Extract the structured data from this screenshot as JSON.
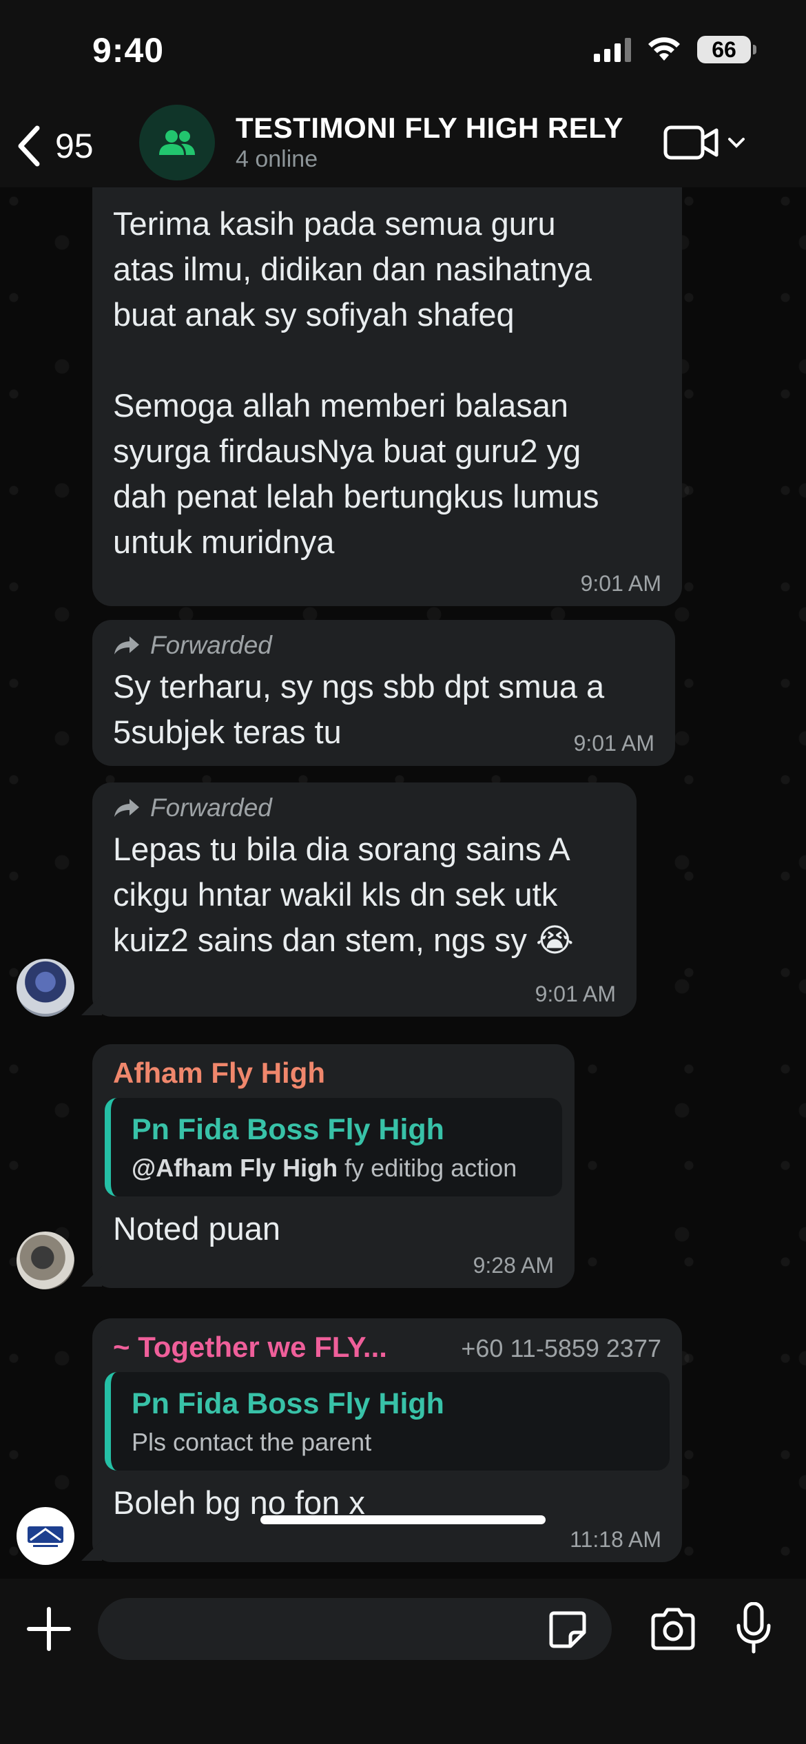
{
  "status_bar": {
    "time": "9:40",
    "battery": "66"
  },
  "header": {
    "back_count": "95",
    "title": "TESTIMONI FLY HIGH RELY",
    "subtitle": "4 online"
  },
  "messages": [
    {
      "text": "Terima kasih pada semua guru\natas ilmu, didikan dan nasihatnya\nbuat anak sy sofiyah shafeq\n\nSemoga allah memberi balasan\nsyurga firdausNya buat guru2 yg\ndah penat lelah bertungkus lumus\nuntuk muridnya",
      "time": "9:01 AM"
    },
    {
      "forwarded": "Forwarded",
      "text": "Sy terharu, sy ngs sbb dpt smua a\n5subjek teras tu",
      "time": "9:01 AM"
    },
    {
      "forwarded": "Forwarded",
      "text": "Lepas tu bila dia sorang sains A\ncikgu hntar wakil kls dn sek utk\nkuiz2 sains dan stem, ngs sy 😭",
      "time": "9:01 AM"
    },
    {
      "sender": "Afham Fly High",
      "quote": {
        "name": "Pn Fida Boss Fly High",
        "mention": "@Afham Fly High",
        "text": " fy editibg action"
      },
      "text": "Noted puan",
      "time": "9:28 AM"
    },
    {
      "sender": "~ Together we FLY...",
      "phone": "+60 11-5859 2377",
      "quote": {
        "name": "Pn Fida Boss Fly High",
        "text": "Pls contact the parent"
      },
      "text": "Boleh bg no fon x",
      "time": "11:18 AM"
    }
  ],
  "colors": {
    "bubble": "#1f2123",
    "sender_afham": "#f0876c",
    "sender_together": "#ef5f9a",
    "quote_accent": "#25c0a6"
  },
  "icons": [
    "back-chevron-icon",
    "group-icon",
    "video-camera-icon",
    "plus-icon",
    "sticker-icon",
    "camera-icon",
    "microphone-icon",
    "forward-arrow-icon"
  ]
}
